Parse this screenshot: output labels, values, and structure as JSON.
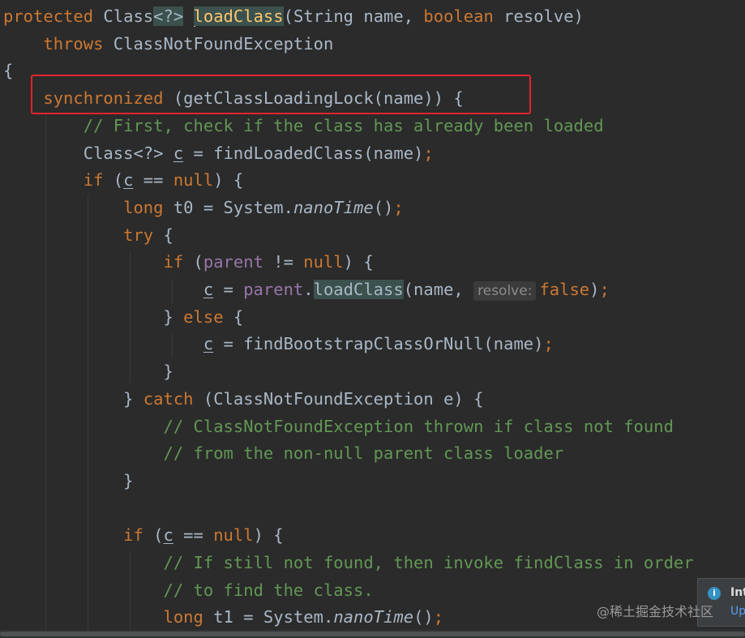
{
  "editor": {
    "lines": [
      [
        {
          "t": "protected",
          "c": "kw"
        },
        {
          "t": " Class"
        },
        {
          "t": "<?>",
          "c": "brhl"
        },
        {
          "t": " "
        },
        {
          "caret": true
        },
        {
          "t": "loadClass",
          "c": "fn brhl"
        },
        {
          "t": "(String name, "
        },
        {
          "t": "boolean",
          "c": "kw"
        },
        {
          "t": " resolve)"
        }
      ],
      [
        {
          "t": "    "
        },
        {
          "t": "throws",
          "c": "kw"
        },
        {
          "t": " ClassNotFoundException"
        }
      ],
      [
        {
          "t": "{"
        }
      ],
      [
        {
          "t": "    "
        },
        {
          "t": "synchronized",
          "c": "kw"
        },
        {
          "t": " (getClassLoadingLock(name)) {"
        }
      ],
      [
        {
          "t": "        "
        },
        {
          "t": "// First, check if the class has already been loaded",
          "c": "cm"
        }
      ],
      [
        {
          "t": "        Class<?> "
        },
        {
          "t": "c",
          "c": "ul"
        },
        {
          "t": " = findLoadedClass(name)"
        },
        {
          "t": ";",
          "c": "kw"
        }
      ],
      [
        {
          "t": "        "
        },
        {
          "t": "if",
          "c": "kw"
        },
        {
          "t": " ("
        },
        {
          "t": "c",
          "c": "ul"
        },
        {
          "t": " == "
        },
        {
          "t": "null",
          "c": "kw"
        },
        {
          "t": ") {"
        }
      ],
      [
        {
          "t": "            "
        },
        {
          "t": "long",
          "c": "kw"
        },
        {
          "t": " t0 = System."
        },
        {
          "t": "nanoTime",
          "c": "it"
        },
        {
          "t": "()"
        },
        {
          "t": ";",
          "c": "kw"
        }
      ],
      [
        {
          "t": "            "
        },
        {
          "t": "try",
          "c": "kw"
        },
        {
          "t": " {"
        }
      ],
      [
        {
          "t": "                "
        },
        {
          "t": "if",
          "c": "kw"
        },
        {
          "t": " ("
        },
        {
          "t": "parent",
          "c": "fd"
        },
        {
          "t": " != "
        },
        {
          "t": "null",
          "c": "kw"
        },
        {
          "t": ") {"
        }
      ],
      [
        {
          "t": "                    "
        },
        {
          "t": "c",
          "c": "ul"
        },
        {
          "t": " = "
        },
        {
          "t": "parent",
          "c": "fd"
        },
        {
          "t": "."
        },
        {
          "t": "loadClass",
          "c": "brhl"
        },
        {
          "t": "(name, "
        },
        {
          "hint": "resolve:"
        },
        {
          "t": "false",
          "c": "kw"
        },
        {
          "t": ")"
        },
        {
          "t": ";",
          "c": "kw"
        }
      ],
      [
        {
          "t": "                } "
        },
        {
          "t": "else",
          "c": "kw"
        },
        {
          "t": " {"
        }
      ],
      [
        {
          "t": "                    "
        },
        {
          "t": "c",
          "c": "ul"
        },
        {
          "t": " = findBootstrapClassOrNull(name)"
        },
        {
          "t": ";",
          "c": "kw"
        }
      ],
      [
        {
          "t": "                }"
        }
      ],
      [
        {
          "t": "            } "
        },
        {
          "t": "catch",
          "c": "kw"
        },
        {
          "t": " (ClassNotFoundException e) {"
        }
      ],
      [
        {
          "t": "                "
        },
        {
          "t": "// ClassNotFoundException thrown if class not found",
          "c": "cm"
        }
      ],
      [
        {
          "t": "                "
        },
        {
          "t": "// from the non-null parent class loader",
          "c": "cm"
        }
      ],
      [
        {
          "t": "            }"
        }
      ],
      [
        {
          "t": ""
        }
      ],
      [
        {
          "t": "            "
        },
        {
          "t": "if",
          "c": "kw"
        },
        {
          "t": " ("
        },
        {
          "t": "c",
          "c": "ul"
        },
        {
          "t": " == "
        },
        {
          "t": "null",
          "c": "kw"
        },
        {
          "t": ") {"
        }
      ],
      [
        {
          "t": "                "
        },
        {
          "t": "// If still not found, then invoke findClass in order",
          "c": "cm"
        }
      ],
      [
        {
          "t": "                "
        },
        {
          "t": "// to find the class.",
          "c": "cm"
        }
      ],
      [
        {
          "t": "                "
        },
        {
          "t": "long",
          "c": "kw"
        },
        {
          "t": " t1 = System."
        },
        {
          "t": "nanoTime",
          "c": "it"
        },
        {
          "t": "()"
        },
        {
          "t": ";",
          "c": "kw"
        }
      ]
    ]
  },
  "notification": {
    "title": "Int",
    "link": "Up",
    "icon": "info-icon"
  },
  "watermark": "@稀土掘金技术社区",
  "colors": {
    "background": "#2b2b2b",
    "keyword": "#cc7832",
    "comment": "#629755",
    "method_declaration": "#ffc66d",
    "field": "#9876aa",
    "default_text": "#a9b7c6",
    "highlight_box": "#e0252d"
  }
}
